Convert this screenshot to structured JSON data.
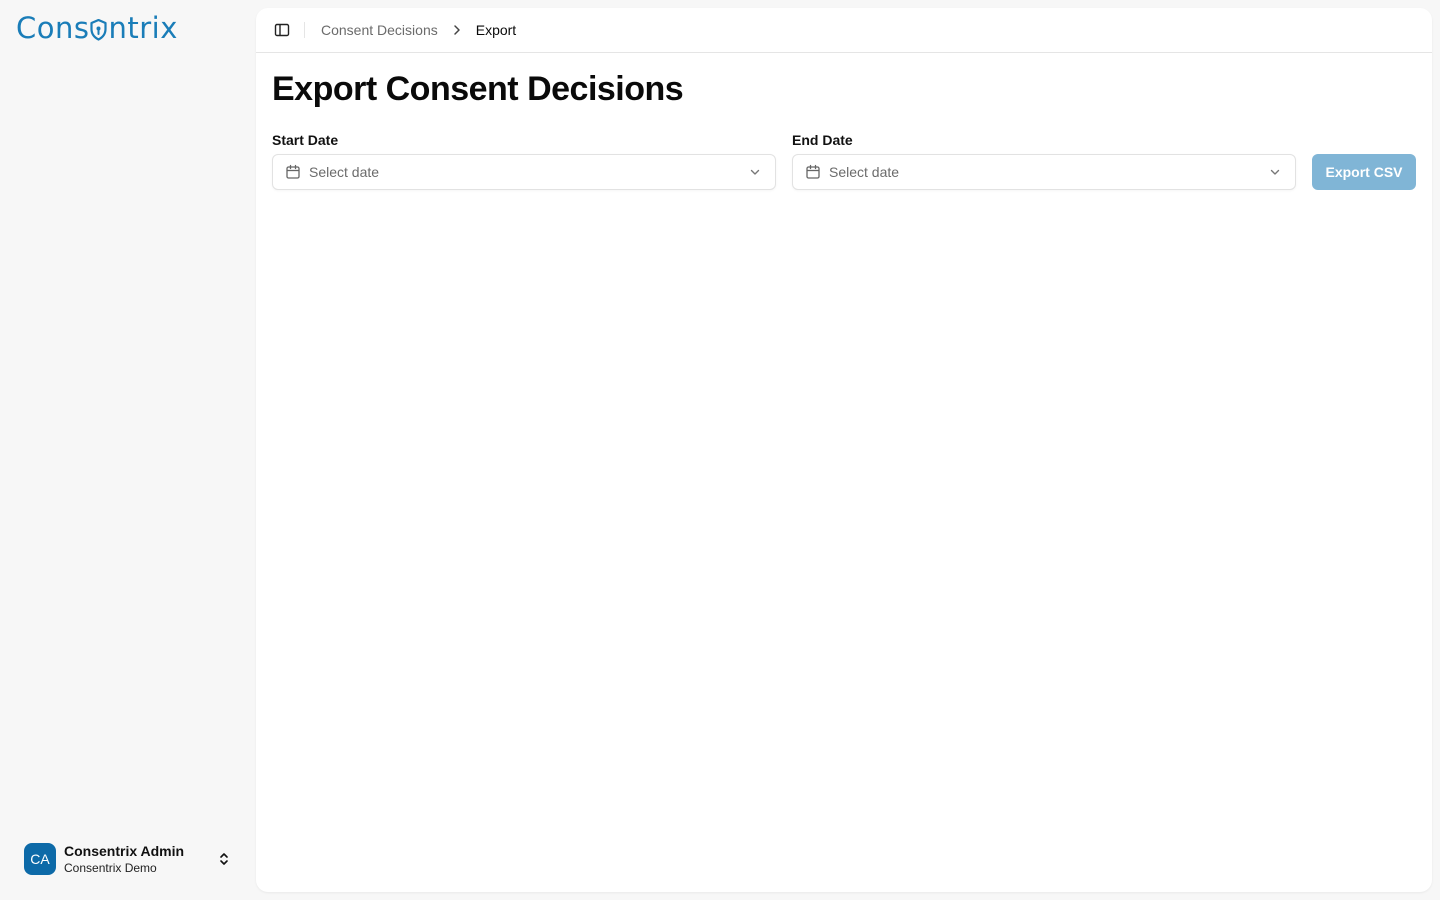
{
  "brand": {
    "logo_text_before": "Cons",
    "logo_text_after": "ntrix",
    "color": "#1a7db8"
  },
  "user": {
    "initials": "CA",
    "name": "Consentrix Admin",
    "org": "Consentrix Demo"
  },
  "breadcrumb": {
    "parent": "Consent Decisions",
    "current": "Export"
  },
  "page": {
    "title": "Export Consent Decisions"
  },
  "form": {
    "start_label": "Start Date",
    "start_placeholder": "Select date",
    "end_label": "End Date",
    "end_placeholder": "Select date",
    "export_label": "Export CSV",
    "export_color": "#80b5d6"
  }
}
